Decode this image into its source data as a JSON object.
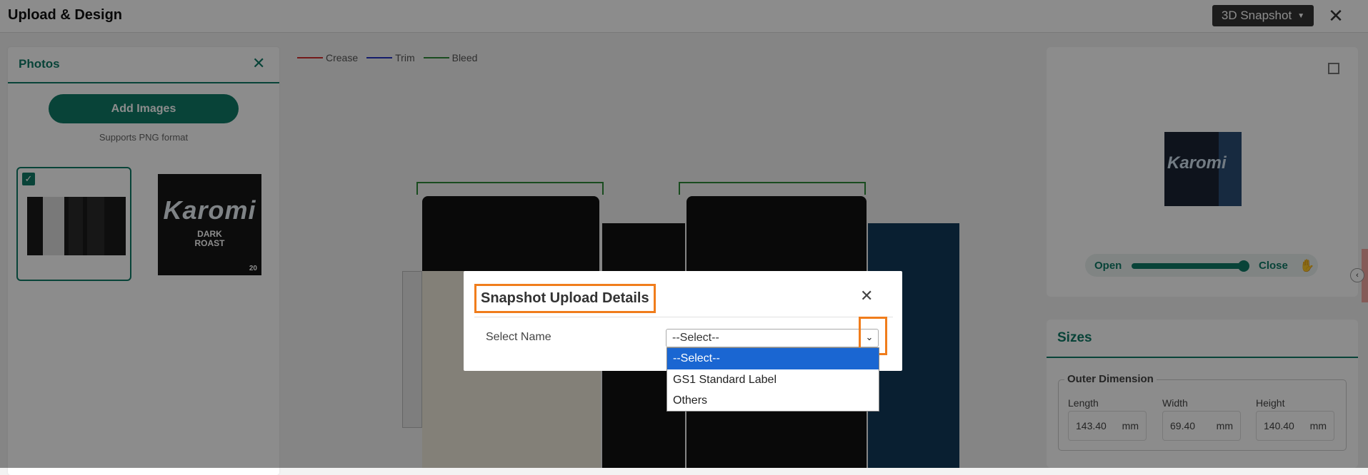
{
  "header": {
    "title": "Upload & Design",
    "snapshot_button": "3D Snapshot",
    "close_glyph": "✕"
  },
  "photos_panel": {
    "title": "Photos",
    "add_images": "Add Images",
    "supports_text": "Supports PNG format",
    "thumb2_brand": "Karomi",
    "thumb2_sub1": "DARK",
    "thumb2_sub2": "ROAST",
    "thumb2_num": "20"
  },
  "legend": {
    "items": [
      {
        "label": "Crease",
        "color": "#d32f2f"
      },
      {
        "label": "Trim",
        "color": "#2432c4"
      },
      {
        "label": "Bleed",
        "color": "#2e8b3a"
      }
    ]
  },
  "preview": {
    "brand": "Karomi",
    "open_label": "Open",
    "close_label": "Close",
    "slider_value": 1.0
  },
  "sizes": {
    "title": "Sizes",
    "group_title": "Outer Dimension",
    "dimensions": [
      {
        "label": "Length",
        "value": "143.40",
        "unit": "mm"
      },
      {
        "label": "Width",
        "value": "69.40",
        "unit": "mm"
      },
      {
        "label": "Height",
        "value": "140.40",
        "unit": "mm"
      }
    ]
  },
  "modal": {
    "title": "Snapshot Upload Details",
    "close_glyph": "✕",
    "field_label": "Select Name",
    "select_value": "--Select--",
    "options": [
      "--Select--",
      "GS1 Standard Label",
      "Others"
    ],
    "selected_index": 0
  },
  "colors": {
    "accent": "#0f7a67",
    "highlight": "#f07d1c",
    "option_selected": "#1a66d2"
  }
}
